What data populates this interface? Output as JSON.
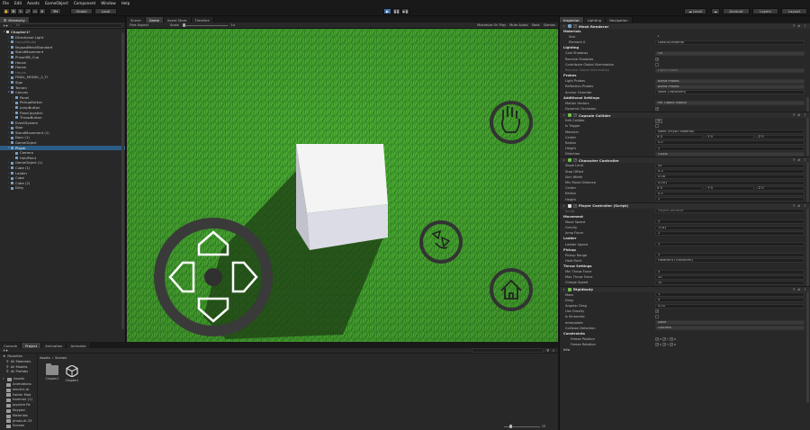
{
  "menu": [
    "File",
    "Edit",
    "Assets",
    "GameObject",
    "Component",
    "Window",
    "Help"
  ],
  "toolbar": {
    "account": "Account",
    "layers": "Layers",
    "layout": "Layout",
    "global": "Global",
    "local": "Local",
    "cloud_label": "☁ Local"
  },
  "hierarchy": {
    "tab": "Hierarchy",
    "search_placeholder": "All",
    "items": [
      {
        "label": "Chapter1*",
        "indent": 0,
        "state": "bold"
      },
      {
        "label": "Directional Light",
        "indent": 1,
        "state": ""
      },
      {
        "label": "HouseModel",
        "indent": 1,
        "state": "dim"
      },
      {
        "label": "KeypadMeshStandard",
        "indent": 1,
        "state": ""
      },
      {
        "label": "StandMovement",
        "indent": 1,
        "state": ""
      },
      {
        "label": "PrisonRB_Cup",
        "indent": 1,
        "state": ""
      },
      {
        "label": "House",
        "indent": 1,
        "state": ""
      },
      {
        "label": "House",
        "indent": 1,
        "state": ""
      },
      {
        "label": "House",
        "indent": 1,
        "state": "dim"
      },
      {
        "label": "FINAL_MODEL_2_T!",
        "indent": 1,
        "state": ""
      },
      {
        "label": "Sign",
        "indent": 1,
        "state": ""
      },
      {
        "label": "Terrain",
        "indent": 1,
        "state": ""
      },
      {
        "label": "Canvas",
        "indent": 1,
        "state": ""
      },
      {
        "label": "Panel",
        "indent": 2,
        "state": ""
      },
      {
        "label": "PickupButton",
        "indent": 2,
        "state": ""
      },
      {
        "label": "JumpButton",
        "indent": 2,
        "state": ""
      },
      {
        "label": "Fixed Joystick",
        "indent": 2,
        "state": ""
      },
      {
        "label": "ThrowButton",
        "indent": 2,
        "state": ""
      },
      {
        "label": "EventSystem",
        "indent": 1,
        "state": ""
      },
      {
        "label": "Stair",
        "indent": 1,
        "state": ""
      },
      {
        "label": "StandMovement (1)",
        "indent": 1,
        "state": ""
      },
      {
        "label": "Door (1)",
        "indent": 1,
        "state": ""
      },
      {
        "label": "GameObject",
        "indent": 1,
        "state": ""
      },
      {
        "label": "Player",
        "indent": 1,
        "state": "sel"
      },
      {
        "label": "Camera",
        "indent": 2,
        "state": ""
      },
      {
        "label": "HoldPoint",
        "indent": 2,
        "state": ""
      },
      {
        "label": "GameObject (1)",
        "indent": 1,
        "state": ""
      },
      {
        "label": "Cube (1)",
        "indent": 1,
        "state": ""
      },
      {
        "label": "Ladder",
        "indent": 1,
        "state": ""
      },
      {
        "label": "Cube",
        "indent": 1,
        "state": ""
      },
      {
        "label": "Cube (2)",
        "indent": 1,
        "state": ""
      },
      {
        "label": "Dirty",
        "indent": 1,
        "state": ""
      }
    ]
  },
  "scene_tabs": [
    {
      "label": "Scene",
      "active": false
    },
    {
      "label": "Game",
      "active": true
    },
    {
      "label": "Asset Store",
      "active": false
    },
    {
      "label": "Timeline",
      "active": false
    }
  ],
  "game_bar": {
    "display": "Free Aspect",
    "scale_label": "Scale",
    "scale_value": "1x",
    "maximize": "Maximize On Play",
    "mute": "Mute Audio",
    "stats": "Stats",
    "gizmos": "Gizmos"
  },
  "bottom": {
    "tabs": [
      {
        "label": "Console",
        "active": false
      },
      {
        "label": "Project",
        "active": true
      },
      {
        "label": "Animation",
        "active": false
      },
      {
        "label": "Animator",
        "active": false
      }
    ],
    "favorites": [
      "All Materials",
      "All Models",
      "All Prefabs"
    ],
    "assets_root": "Assets",
    "asset_folders": [
      "Animations",
      "electric-dr",
      "Folder Mod",
      "hammer (1)",
      "Joystick Pa",
      "Keypad",
      "Materials",
      "photo-di-33",
      "Scenes"
    ],
    "breadcrumb": [
      "Assets",
      "Scenes"
    ],
    "files": [
      "Chapter1",
      "Chapter1"
    ],
    "slider_count": "13"
  },
  "inspector": {
    "tabs": [
      {
        "label": "Inspector",
        "active": true
      },
      {
        "label": "Lighting",
        "active": false
      },
      {
        "label": "Navigation",
        "active": false
      }
    ],
    "mesh_renderer": {
      "title": "Mesh Renderer",
      "materials_label": "Materials",
      "size_label": "Size",
      "size_value": "1",
      "element0_label": "Element 0",
      "element0_value": "Default-Material",
      "lighting_label": "Lighting",
      "cast_shadows_label": "Cast Shadows",
      "cast_shadows_value": "On",
      "receive_shadows_label": "Receive Shadows",
      "contribute_gi_label": "Contribute Global Illumination",
      "receive_gi_label": "Receive Global Illumination",
      "receive_gi_value": "Light Probes",
      "probes_label": "Probes",
      "light_probes_label": "Light Probes",
      "light_probes_value": "Blend Probes",
      "reflection_probes_label": "Reflection Probes",
      "reflection_probes_value": "Blend Probes",
      "anchor_override_label": "Anchor Override",
      "anchor_override_value": "None (Transform)",
      "additional_label": "Additional Settings",
      "motion_vectors_label": "Motion Vectors",
      "motion_vectors_value": "Per Object Motion",
      "dynamic_occlusion_label": "Dynamic Occlusion"
    },
    "capsule": {
      "title": "Capsule Collider",
      "edit_label": "Edit Collider",
      "trigger_label": "Is Trigger",
      "material_label": "Material",
      "material_value": "None (Physic Material)",
      "center_label": "Center",
      "center_x": "X 0",
      "center_y": "Y 0",
      "center_z": "Z 0",
      "radius_label": "Radius",
      "radius_value": "0.5",
      "height_label": "Height",
      "height_value": "2",
      "direction_label": "Direction",
      "direction_value": "Y-Axis"
    },
    "char_ctrl": {
      "title": "Character Controller",
      "slope_label": "Slope Limit",
      "slope_value": "45",
      "step_label": "Step Offset",
      "step_value": "0.3",
      "skin_label": "Skin Width",
      "skin_value": "0.08",
      "minmove_label": "Min Move Distance",
      "minmove_value": "0.001",
      "center_label": "Center",
      "center_x": "X 0",
      "center_y": "Y 0",
      "center_z": "Z 0",
      "radius_label": "Radius",
      "radius_value": "0.5",
      "height_label": "Height",
      "height_value": "2"
    },
    "player_ctrl": {
      "title": "Player Controller (Script)",
      "script_label": "Script",
      "script_value": "PlayerController",
      "movement_label": "Movement",
      "move_speed_label": "Move Speed",
      "move_speed_value": "5",
      "gravity_label": "Gravity",
      "gravity_value": "-9.81",
      "jump_label": "Jump Force",
      "jump_value": "2",
      "ladder_section": "Ladder",
      "ladder_speed_label": "Ladder Speed",
      "ladder_speed_value": "3",
      "pickup_section": "Pickup",
      "pickup_range_label": "Pickup Range",
      "pickup_range_value": "3",
      "hold_point_label": "Hold Point",
      "hold_point_value": "HoldPoint (Transform)",
      "throw_section": "Throw Settings",
      "min_throw_label": "Min Throw Force",
      "min_throw_value": "5",
      "max_throw_label": "Max Throw Force",
      "max_throw_value": "20",
      "charge_label": "Charge Speed",
      "charge_value": "10"
    },
    "rigidbody": {
      "title": "Rigidbody",
      "mass_label": "Mass",
      "mass_value": "1",
      "drag_label": "Drag",
      "drag_value": "0",
      "angular_label": "Angular Drag",
      "angular_value": "0.05",
      "gravity_label": "Use Gravity",
      "kinematic_label": "Is Kinematic",
      "interp_label": "Interpolate",
      "interp_value": "None",
      "collision_label": "Collision Detection",
      "collision_value": "Discrete",
      "constraints_label": "Constraints",
      "freeze_pos_label": "Freeze Position",
      "freeze_rot_label": "Freeze Rotation",
      "xyz": "X Y Z",
      "info_label": "Info"
    }
  }
}
